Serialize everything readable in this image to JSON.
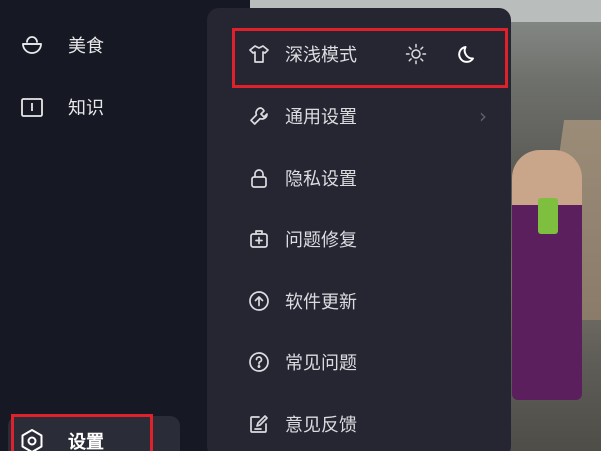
{
  "sidebar": {
    "items": [
      {
        "label": "美食",
        "icon": "basket-icon"
      },
      {
        "label": "知识",
        "icon": "book-icon"
      },
      {
        "label": "设置",
        "icon": "settings-icon"
      }
    ]
  },
  "menu": {
    "items": [
      {
        "label": "深浅模式",
        "icon": "shirt-icon"
      },
      {
        "label": "通用设置",
        "icon": "wrench-icon"
      },
      {
        "label": "隐私设置",
        "icon": "lock-icon"
      },
      {
        "label": "问题修复",
        "icon": "repair-kit-icon"
      },
      {
        "label": "软件更新",
        "icon": "upload-circle-icon"
      },
      {
        "label": "常见问题",
        "icon": "question-icon"
      },
      {
        "label": "意见反馈",
        "icon": "edit-icon"
      }
    ],
    "theme_options": [
      "sun-icon",
      "moon-icon"
    ]
  },
  "colors": {
    "highlight": "#e0202a",
    "menu_bg": "#252632",
    "sidebar_bg": "#161823"
  }
}
